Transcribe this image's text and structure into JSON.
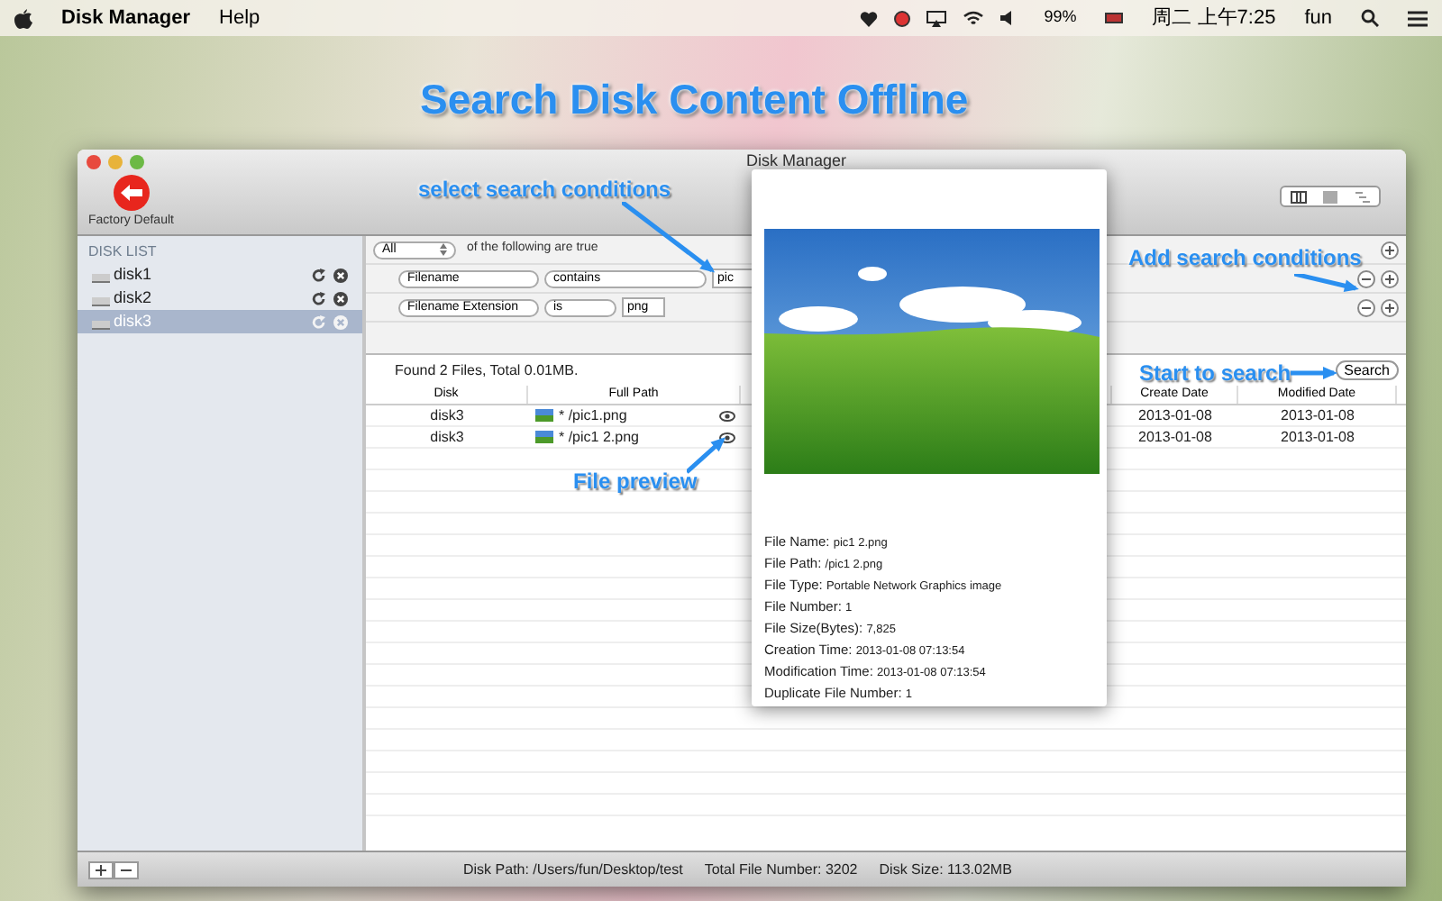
{
  "menubar": {
    "app_name": "Disk Manager",
    "menus": [
      "Help"
    ],
    "battery": "99%",
    "clock": "周二 上午7:25",
    "user": "fun"
  },
  "headline": "Search Disk Content Offline",
  "window": {
    "title": "Disk Manager",
    "toolbar_button": "Factory Default"
  },
  "sidebar": {
    "header": "DISK LIST",
    "items": [
      {
        "label": "disk1",
        "selected": false
      },
      {
        "label": "disk2",
        "selected": false
      },
      {
        "label": "disk3",
        "selected": true
      }
    ]
  },
  "search": {
    "match": "All",
    "match_suffix": "of the following are true",
    "conditions": [
      {
        "field": "Filename",
        "operator": "contains",
        "value": "pic"
      },
      {
        "field": "Filename Extension",
        "operator": "is",
        "value": "png"
      }
    ],
    "summary": "Found 2 Files, Total 0.01MB.",
    "button": "Search"
  },
  "table": {
    "columns": [
      "Disk",
      "Full Path",
      "Create Date",
      "Modified Date"
    ],
    "rows": [
      {
        "disk": "disk3",
        "path": "* /pic1.png",
        "create_date": "2013-01-08",
        "modified_date": "2013-01-08"
      },
      {
        "disk": "disk3",
        "path": "* /pic1 2.png",
        "create_date": "2013-01-08",
        "modified_date": "2013-01-08"
      }
    ]
  },
  "preview": {
    "details": [
      {
        "label": "File Name:",
        "value": "pic1 2.png"
      },
      {
        "label": "File Path:",
        "value": "/pic1 2.png"
      },
      {
        "label": "File Type:",
        "value": "Portable Network Graphics image"
      },
      {
        "label": "File Number:",
        "value": "1"
      },
      {
        "label": "File Size(Bytes):",
        "value": "7,825"
      },
      {
        "label": "Creation Time:",
        "value": "2013-01-08 07:13:54"
      },
      {
        "label": "Modification Time:",
        "value": "2013-01-08 07:13:54"
      },
      {
        "label": "Duplicate File Number:",
        "value": "1"
      }
    ]
  },
  "status_bar": [
    "Disk Path: /Users/fun/Desktop/test",
    "Total File Number: 3202",
    "Disk Size: 113.02MB"
  ],
  "annotations": [
    "select search conditions",
    "Add search conditions",
    "Start to search",
    "File preview"
  ]
}
